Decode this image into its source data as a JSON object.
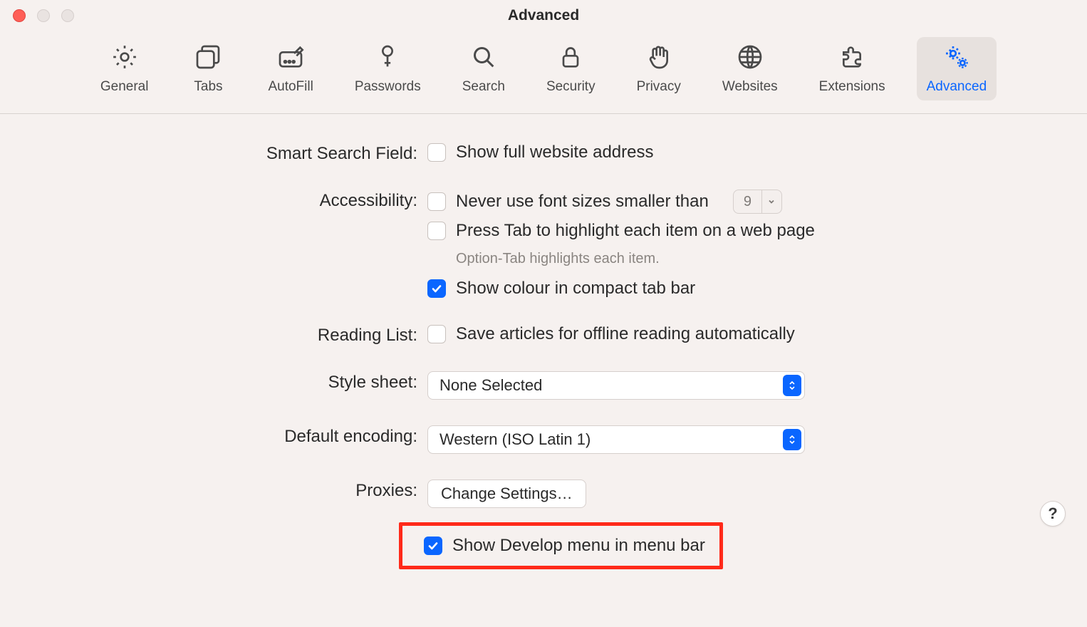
{
  "window": {
    "title": "Advanced"
  },
  "tabs": {
    "general": "General",
    "tabs": "Tabs",
    "autofill": "AutoFill",
    "passwords": "Passwords",
    "search": "Search",
    "security": "Security",
    "privacy": "Privacy",
    "websites": "Websites",
    "extensions": "Extensions",
    "advanced": "Advanced"
  },
  "sections": {
    "smart_search": {
      "label": "Smart Search Field:",
      "show_full_address": {
        "text": "Show full website address",
        "checked": false
      }
    },
    "accessibility": {
      "label": "Accessibility:",
      "never_smaller": {
        "text": "Never use font sizes smaller than",
        "checked": false,
        "value": "9"
      },
      "press_tab": {
        "text": "Press Tab to highlight each item on a web page",
        "checked": false
      },
      "hint": "Option-Tab highlights each item.",
      "show_colour": {
        "text": "Show colour in compact tab bar",
        "checked": true
      }
    },
    "reading_list": {
      "label": "Reading List:",
      "save_offline": {
        "text": "Save articles for offline reading automatically",
        "checked": false
      }
    },
    "style_sheet": {
      "label": "Style sheet:",
      "value": "None Selected"
    },
    "default_encoding": {
      "label": "Default encoding:",
      "value": "Western (ISO Latin 1)"
    },
    "proxies": {
      "label": "Proxies:",
      "button": "Change Settings…"
    },
    "develop": {
      "text": "Show Develop menu in menu bar",
      "checked": true
    }
  },
  "help": "?"
}
